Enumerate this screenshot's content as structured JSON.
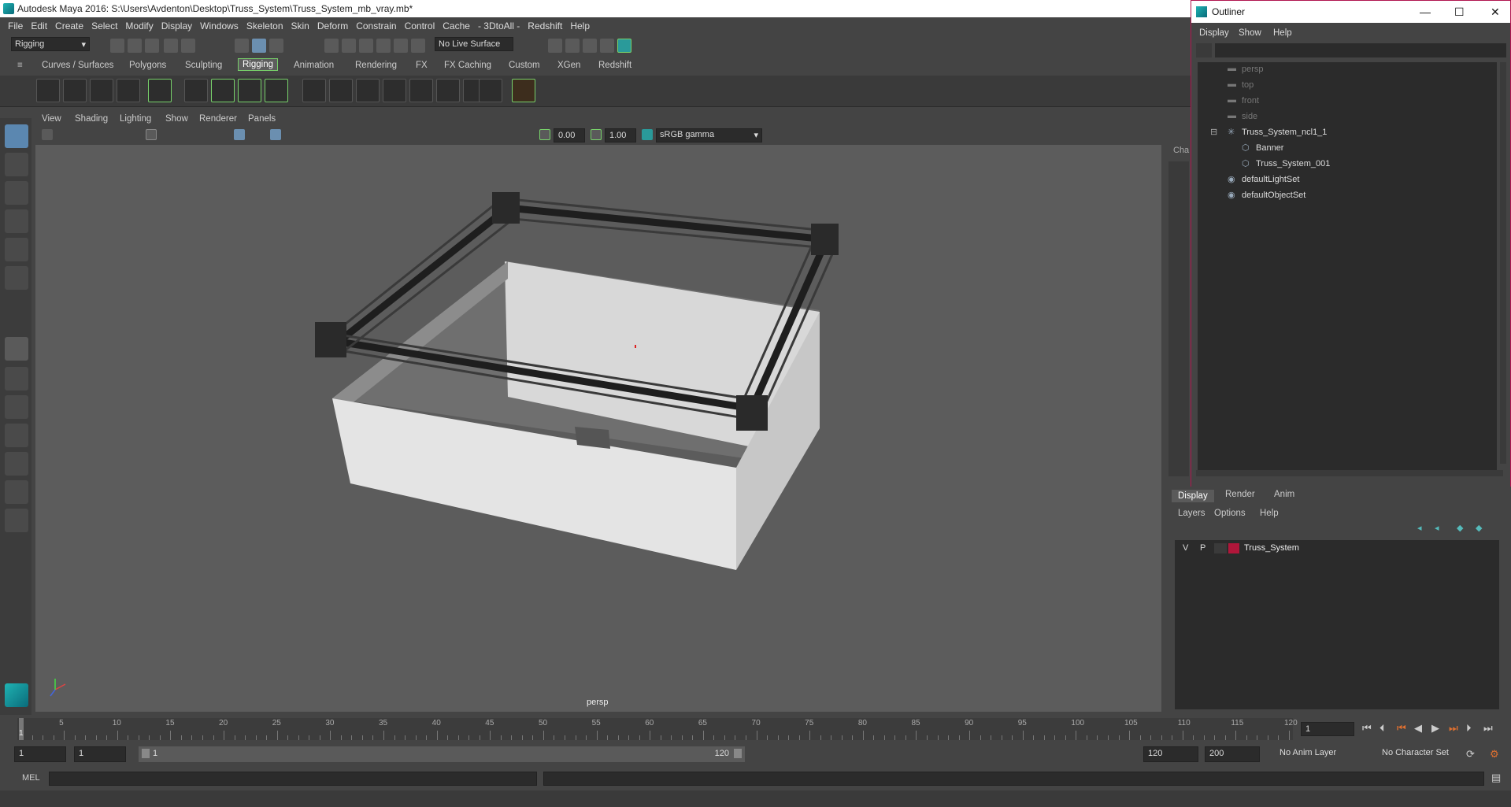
{
  "window": {
    "title": "Autodesk Maya 2016: S:\\Users\\Avdenton\\Desktop\\Truss_System\\Truss_System_mb_vray.mb*"
  },
  "menubar": [
    "File",
    "Edit",
    "Create",
    "Select",
    "Modify",
    "Display",
    "Windows",
    "Skeleton",
    "Skin",
    "Deform",
    "Constrain",
    "Control",
    "Cache",
    "- 3DtoAll -",
    "Redshift",
    "Help"
  ],
  "statusline": {
    "mode": "Rigging",
    "live_surface": "No Live Surface"
  },
  "shelf_tabs": [
    "Curves / Surfaces",
    "Polygons",
    "Sculpting",
    "Rigging",
    "Animation",
    "Rendering",
    "FX",
    "FX Caching",
    "Custom",
    "XGen",
    "Redshift"
  ],
  "shelf_active": "Rigging",
  "panel_menu": [
    "View",
    "Shading",
    "Lighting",
    "Show",
    "Renderer",
    "Panels"
  ],
  "panel_toolbar": {
    "exposure": "0.00",
    "gamma": "1.00",
    "colorspace": "sRGB gamma"
  },
  "viewport": {
    "camera_label": "persp"
  },
  "outliner": {
    "title": "Outliner",
    "menu": [
      "Display",
      "Show",
      "Help"
    ],
    "items": [
      {
        "label": "persp",
        "icon": "camera-icon",
        "level": 0,
        "dim": true
      },
      {
        "label": "top",
        "icon": "camera-icon",
        "level": 0,
        "dim": true
      },
      {
        "label": "front",
        "icon": "camera-icon",
        "level": 0,
        "dim": true
      },
      {
        "label": "side",
        "icon": "camera-icon",
        "level": 0,
        "dim": true
      },
      {
        "label": "Truss_System_ncl1_1",
        "icon": "group-icon",
        "level": 0,
        "dim": false
      },
      {
        "label": "Banner",
        "icon": "mesh-icon",
        "level": 1,
        "dim": false
      },
      {
        "label": "Truss_System_001",
        "icon": "mesh-icon",
        "level": 1,
        "dim": false
      },
      {
        "label": "defaultLightSet",
        "icon": "set-icon",
        "level": 0,
        "dim": false
      },
      {
        "label": "defaultObjectSet",
        "icon": "set-icon",
        "level": 0,
        "dim": false
      }
    ]
  },
  "channel_box": {
    "tab_label": "Cha"
  },
  "layer_panel": {
    "tabs": [
      "Display",
      "Render",
      "Anim"
    ],
    "active_tab": "Display",
    "menu": [
      "Layers",
      "Options",
      "Help"
    ],
    "layers": [
      {
        "v": "V",
        "p": "P",
        "name": "Truss_System",
        "color": "#b0163a"
      }
    ]
  },
  "timeline": {
    "ticks": [
      "5",
      "10",
      "15",
      "20",
      "25",
      "30",
      "35",
      "40",
      "45",
      "50",
      "55",
      "60",
      "65",
      "70",
      "75",
      "80",
      "85",
      "90",
      "95",
      "100",
      "105",
      "110",
      "115",
      "120"
    ],
    "current": "1",
    "current_frame_field": "1"
  },
  "range": {
    "start": "1",
    "anim_start": "1",
    "slider_start": "1",
    "slider_end": "120",
    "end": "120",
    "anim_end": "200",
    "anim_layer": "No Anim Layer",
    "char_set": "No Character Set"
  },
  "command": {
    "lang": "MEL"
  },
  "colors": {
    "accent_green": "#78d26b",
    "outliner_border": "#b0164f",
    "viewport_bg": "#5c5c5c"
  }
}
